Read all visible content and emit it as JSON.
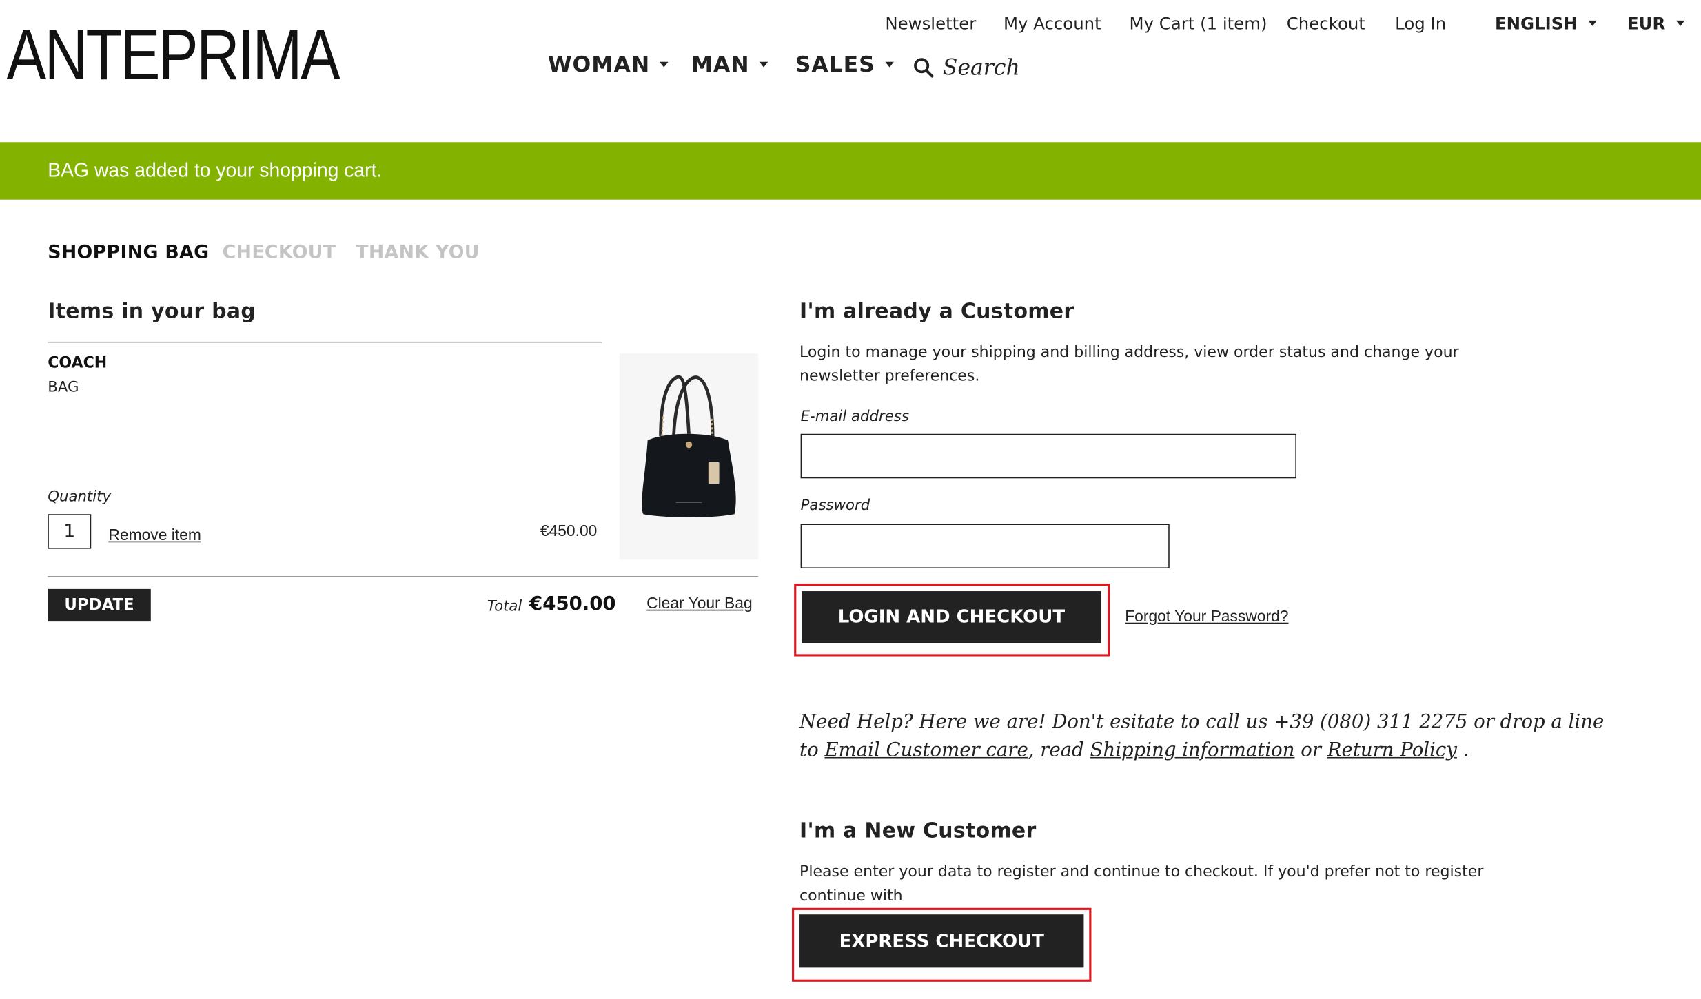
{
  "brand": {
    "logo_text": "ANTEPRIMA"
  },
  "top_links": {
    "newsletter": "Newsletter",
    "account": "My Account",
    "cart": "My Cart (1 item)",
    "checkout": "Checkout",
    "login": "Log In",
    "language": "ENGLISH",
    "currency": "EUR"
  },
  "nav": {
    "woman": "WOMAN",
    "man": "MAN",
    "sales": "SALES",
    "search": "Search"
  },
  "banner": {
    "message": "BAG was added to your shopping cart.",
    "color": "#83b300"
  },
  "steps": [
    "SHOPPING BAG",
    "CHECKOUT",
    "THANK YOU"
  ],
  "bag": {
    "title": "Items in your bag",
    "items": [
      {
        "brand": "COACH",
        "name": "BAG",
        "quantity": "1",
        "price": "€450.00",
        "image": "black-handbag"
      }
    ],
    "quantity_label": "Quantity",
    "remove_label": "Remove item",
    "update_label": "UPDATE",
    "total_label": "Total",
    "total_value": "€450.00",
    "clear_label": "Clear Your Bag"
  },
  "existing_customer": {
    "title": "I'm already a Customer",
    "description_line1": "Login to manage your shipping and billing address, view order status and change your",
    "description_line2": "newsletter preferences.",
    "email_label": "E-mail address",
    "email_value": "",
    "password_label": "Password",
    "password_value": "",
    "login_button": "LOGIN AND CHECKOUT",
    "forgot_link": "Forgot Your Password?"
  },
  "help": {
    "line1": "Need Help? Here we are! Don't esitate to call us +39 (080) 311 2275 or drop a line",
    "to": "to",
    "email_link": "Email Customer care",
    "read": ", read",
    "shipping_link": "Shipping information",
    "or": "or",
    "return_link": "Return Policy",
    "end": "."
  },
  "new_customer": {
    "title": "I'm a New Customer",
    "description_line1": "Please enter your data to register and continue to checkout. If you'd prefer not to register",
    "description_line2": "continue with",
    "express_button": "EXPRESS CHECKOUT"
  },
  "highlight_color": "#e0161e"
}
